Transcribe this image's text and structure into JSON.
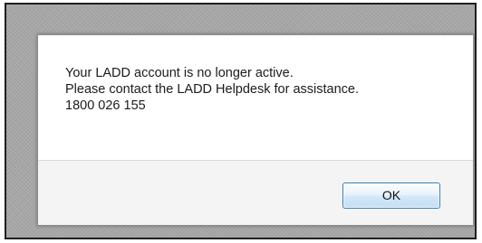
{
  "dialog": {
    "message_lines": [
      "Your LADD account is no longer active.",
      "Please contact the LADD Helpdesk for assistance.",
      "1800 026 155"
    ],
    "ok_label": "OK"
  }
}
